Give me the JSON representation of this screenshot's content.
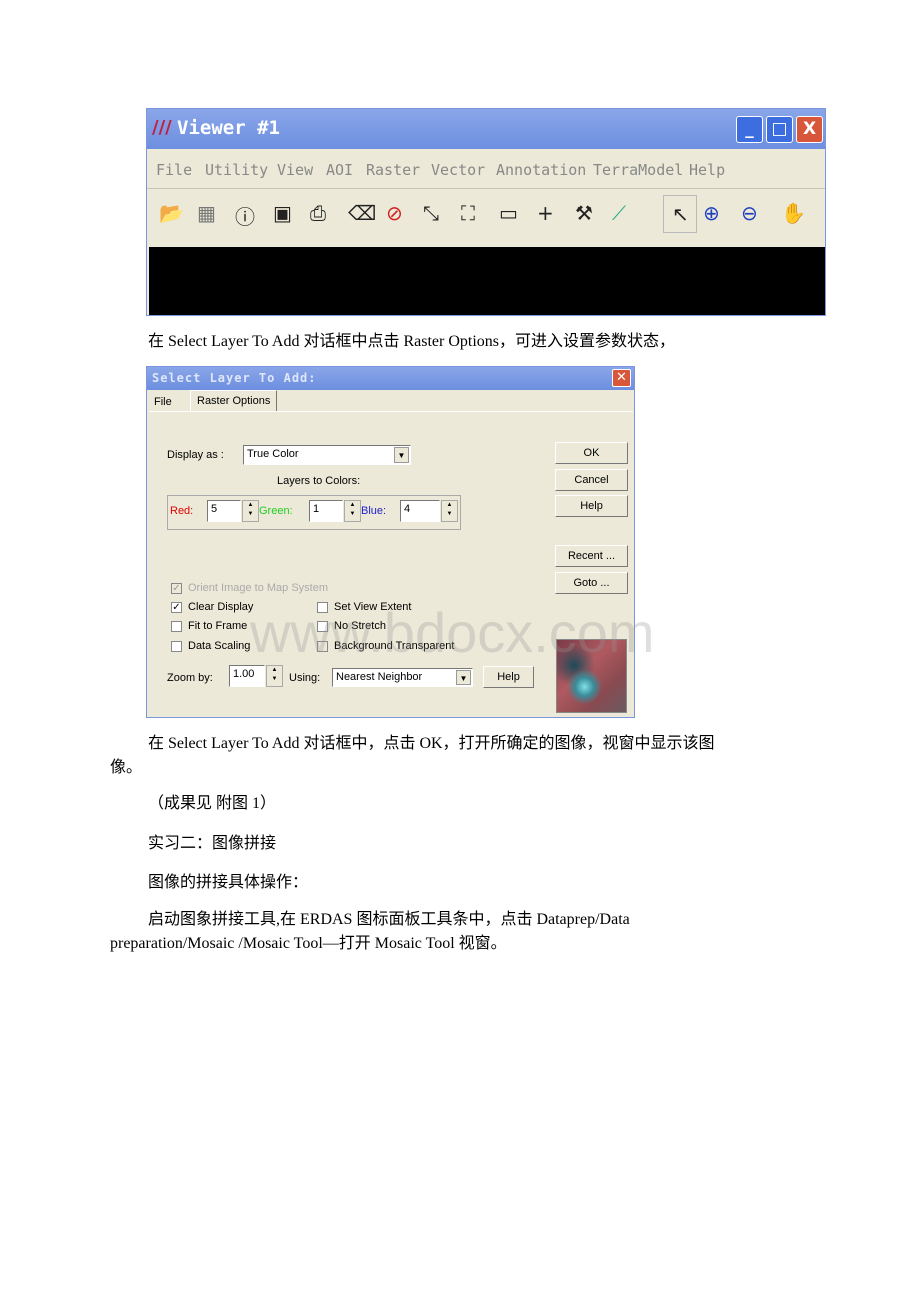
{
  "viewer": {
    "title": "Viewer #1",
    "menu": [
      "File",
      "Utility",
      "View",
      "AOI",
      "Raster",
      "Vector",
      "Annotation",
      "TerraModel",
      "Help"
    ],
    "toolbar_icons": [
      "open-folder-icon",
      "open-layer-icon",
      "info-icon",
      "save-icon",
      "print-icon",
      "eraser-icon",
      "clear-icon",
      "zoom-in-fit-icon",
      "zoom-out-fit-icon",
      "ruler-icon",
      "crosshair-icon",
      "hammer-icon",
      "profile-icon",
      "pointer-icon",
      "zoom-in-icon",
      "zoom-out-icon",
      "hand-icon"
    ]
  },
  "text": {
    "p1": "在 Select Layer To Add 对话框中点击 Raster Options，可进入设置参数状态，",
    "p2a": "在 Select Layer To Add 对话框中，点击 OK，打开所确定的图像，视窗中显示该图",
    "p2b": "像。",
    "p3": "（成果见 附图 1）",
    "p4": "实习二：图像拼接",
    "p5": "图像的拼接具体操作：",
    "p6a": "启动图象拼接工具,在 ERDAS 图标面板工具条中，点击 Dataprep/Data",
    "p6b": "preparation/Mosaic /Mosaic Tool—打开 Mosaic Tool 视窗。"
  },
  "dialog": {
    "title": "Select Layer To Add:",
    "tabs": [
      "File",
      "Raster Options"
    ],
    "display_as_label": "Display as :",
    "display_as_value": "True Color",
    "layers_label": "Layers to Colors:",
    "red_label": "Red:",
    "red": "5",
    "green_label": "Green:",
    "green": "1",
    "blue_label": "Blue:",
    "blue": "4",
    "buttons": {
      "ok": "OK",
      "cancel": "Cancel",
      "help": "Help",
      "recent": "Recent ...",
      "goto": "Goto ..."
    },
    "checks": {
      "orient": "Orient Image to Map System",
      "clear": "Clear Display",
      "fit": "Fit to Frame",
      "scaling": "Data Scaling",
      "extent": "Set View Extent",
      "nostretch": "No Stretch",
      "bgtrans": "Background Transparent"
    },
    "zoom_label": "Zoom by:",
    "zoom": "1.00",
    "using_label": "Using:",
    "using": "Nearest Neighbor",
    "help2": "Help",
    "colors": {
      "red": "#e00000",
      "green": "#20d020",
      "blue": "#2020d0"
    }
  },
  "watermark": "www.bdocx.com"
}
